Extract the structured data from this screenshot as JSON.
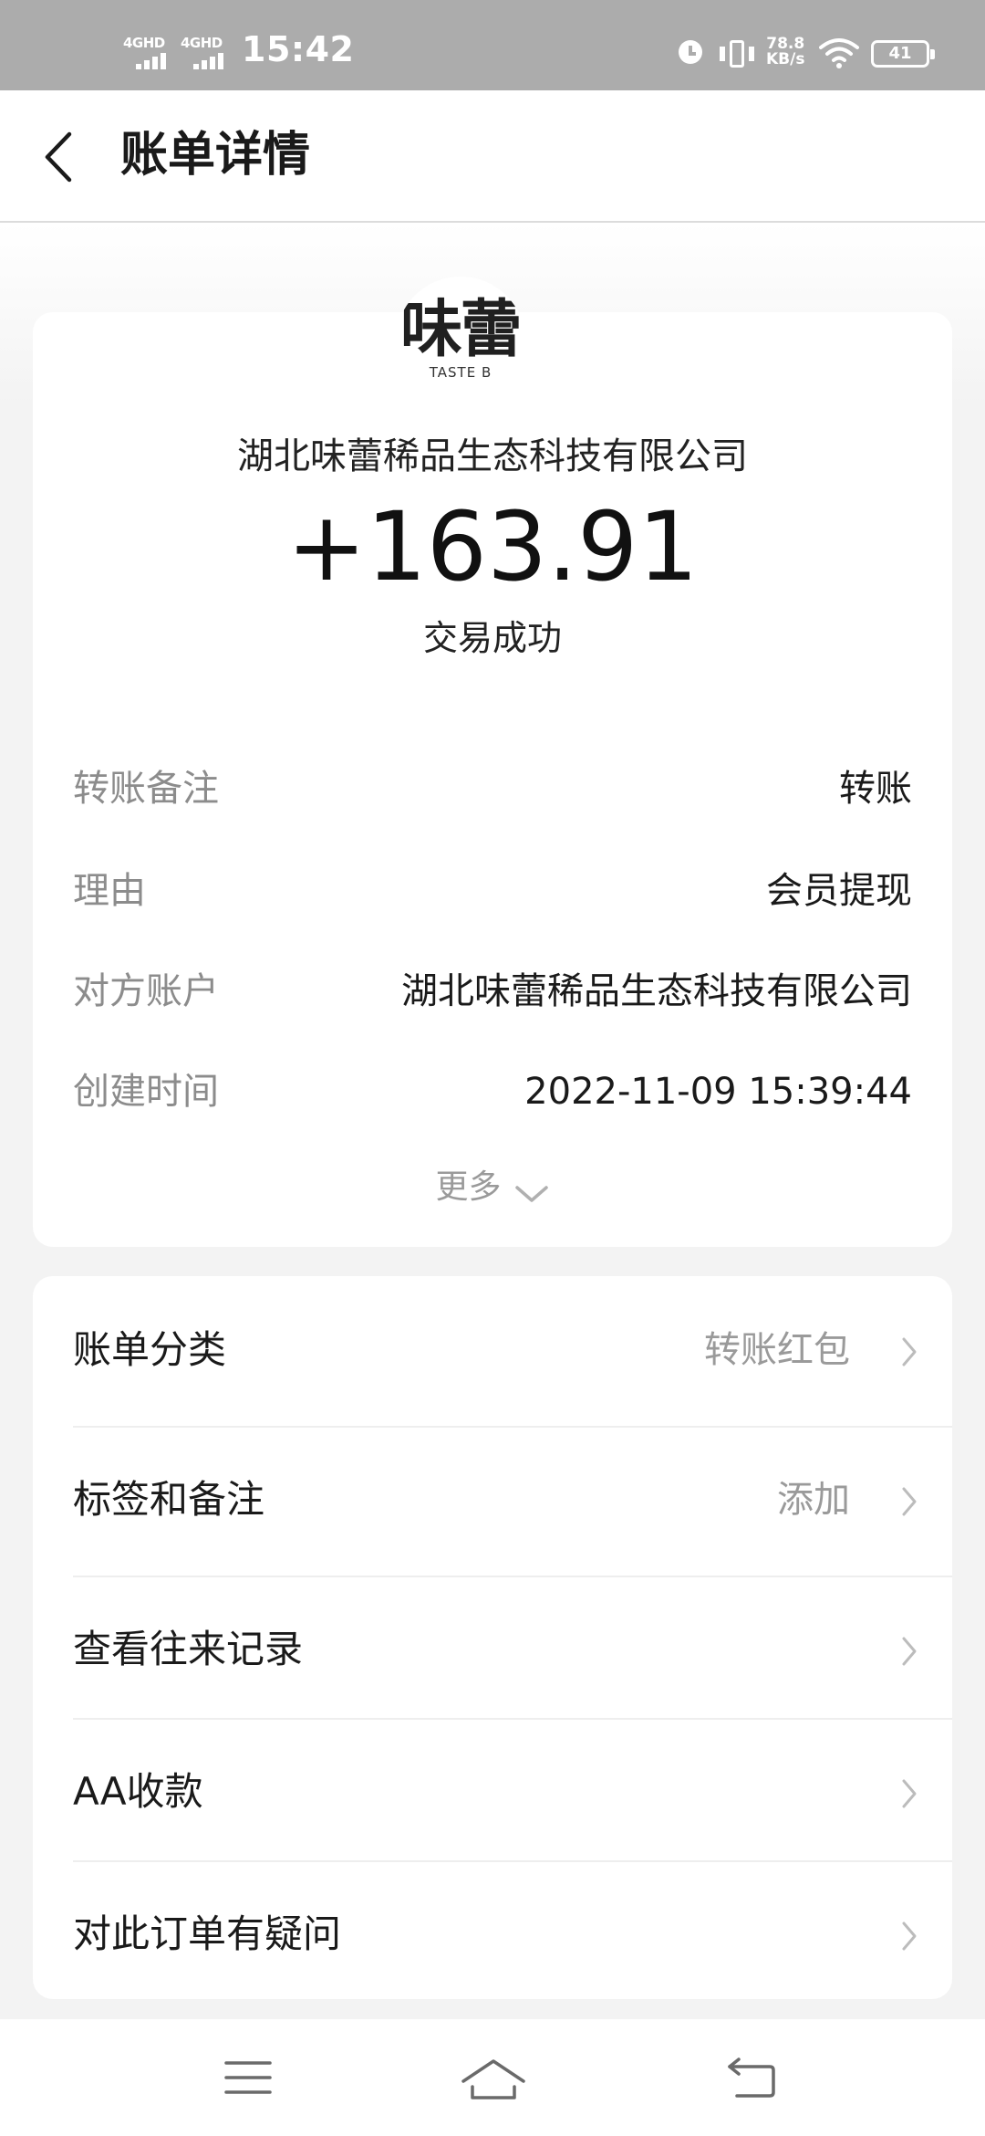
{
  "status_bar": {
    "sim1": "4GHD",
    "sim2": "4GHD",
    "time": "15:42",
    "net_speed_value": "78.8",
    "net_speed_unit": "KB/s",
    "battery": "41"
  },
  "header": {
    "title": "账单详情"
  },
  "summary": {
    "logo_text": "味蕾",
    "logo_sub": "TASTE B",
    "company": "湖北味蕾稀品生态科技有限公司",
    "amount": "+163.91",
    "status": "交易成功"
  },
  "details": [
    {
      "label": "转账备注",
      "value": "转账"
    },
    {
      "label": "理由",
      "value": "会员提现"
    },
    {
      "label": "对方账户",
      "value": "湖北味蕾稀品生态科技有限公司"
    },
    {
      "label": "创建时间",
      "value": "2022-11-09 15:39:44"
    }
  ],
  "more_label": "更多",
  "menu": [
    {
      "label": "账单分类",
      "value": "转账红包"
    },
    {
      "label": "标签和备注",
      "value": "添加"
    },
    {
      "label": "查看往来记录",
      "value": ""
    },
    {
      "label": "AA收款",
      "value": ""
    },
    {
      "label": "对此订单有疑问",
      "value": ""
    }
  ]
}
